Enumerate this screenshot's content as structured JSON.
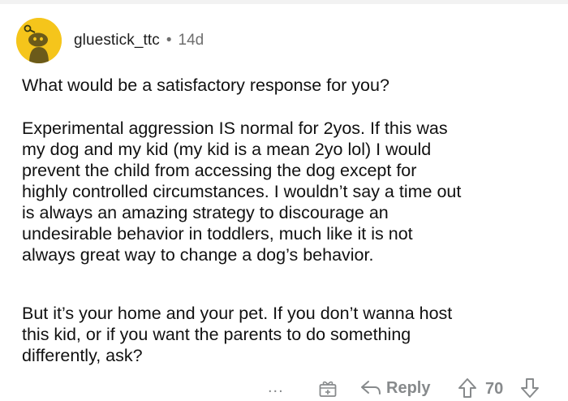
{
  "comment": {
    "username": "gluestick_ttc",
    "separator": "•",
    "age": "14d",
    "paragraphs": [
      {
        "lines": [
          "What would be a satisfactory response for you?"
        ]
      },
      {
        "lines": [
          "Experimental aggression IS normal for 2yos.  If this was",
          "my dog and my kid (my kid is a mean 2yo lol) I would",
          "prevent the child from accessing the dog except for",
          "highly controlled circumstances.  I wouldn’t say a time out",
          "is always an amazing strategy to discourage an",
          "undesirable behavior in toddlers, much like it is not",
          "always great way to change a dog’s behavior."
        ]
      },
      {
        "lines": [
          "But it’s your home and your pet.  If you don’t wanna host",
          "this kid, or if you want the parents to do something",
          "differently, ask?"
        ]
      }
    ],
    "actions": {
      "more_label": "...",
      "reply_label": "Reply",
      "score": "70"
    }
  },
  "icons": {
    "avatar": "snoo-avatar-icon",
    "more": "more-options-icon",
    "award": "award-gift-icon",
    "reply": "reply-arrow-icon",
    "upvote": "upvote-arrow-icon",
    "downvote": "downvote-arrow-icon"
  },
  "colors": {
    "avatar_bg": "#f5c51b",
    "meta_gray": "#878a8c",
    "text": "#111111"
  }
}
